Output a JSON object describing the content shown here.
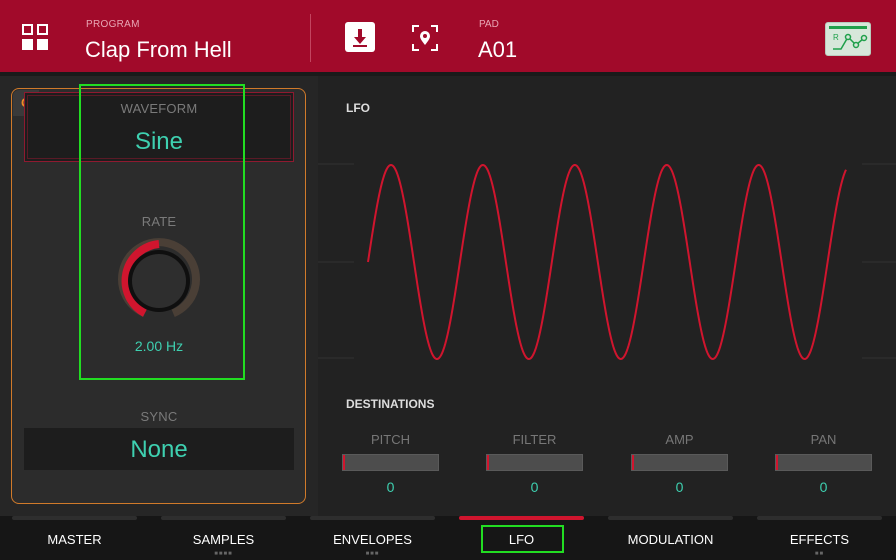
{
  "header": {
    "program_label": "PROGRAM",
    "program_value": "Clap From Hell",
    "pad_label": "PAD",
    "pad_value": "A01",
    "icons": [
      "grid-menu-icon",
      "save-icon",
      "locate-icon",
      "automation-icon"
    ],
    "automation_icon_letter": "R"
  },
  "left": {
    "q_badge": "Q",
    "waveform_label": "WAVEFORM",
    "waveform_value": "Sine",
    "rate_label": "RATE",
    "rate_value": "2.00 Hz",
    "sync_label": "SYNC",
    "sync_value": "None"
  },
  "right": {
    "lfo_title": "LFO",
    "destinations_title": "DESTINATIONS",
    "destinations": [
      {
        "name": "PITCH",
        "value": "0"
      },
      {
        "name": "FILTER",
        "value": "0"
      },
      {
        "name": "AMP",
        "value": "0"
      },
      {
        "name": "PAN",
        "value": "0"
      }
    ]
  },
  "tabs": [
    {
      "label": "MASTER",
      "active": false,
      "dots": ""
    },
    {
      "label": "SAMPLES",
      "active": false,
      "dots": "■■■■"
    },
    {
      "label": "ENVELOPES",
      "active": false,
      "dots": "■■■"
    },
    {
      "label": "LFO",
      "active": true,
      "dots": ""
    },
    {
      "label": "MODULATION",
      "active": false,
      "dots": ""
    },
    {
      "label": "EFFECTS",
      "active": false,
      "dots": "■■"
    }
  ],
  "colors": {
    "header_bg": "#a10a2a",
    "accent_red": "#d0152e",
    "value_teal": "#3ed0b0",
    "panel_orange": "#d07a2a",
    "highlight_green": "#22dd22"
  }
}
